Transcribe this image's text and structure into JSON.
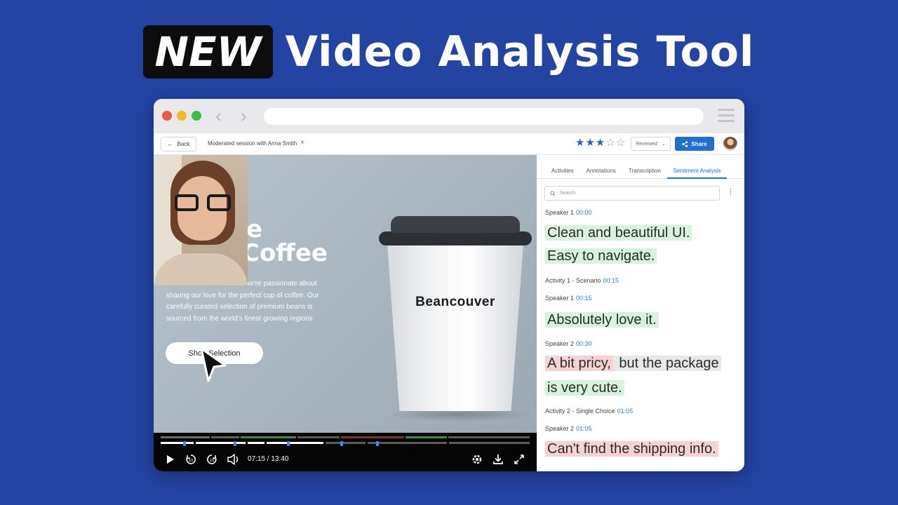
{
  "headline": {
    "badge": "NEW",
    "title": "Video Analysis Tool"
  },
  "app_bar": {
    "back_label": "Back",
    "session_title": "Moderated session with Anna Smith",
    "close_glyph": "×",
    "rating": {
      "value": 3,
      "max": 5
    },
    "status_value": "Reviewed",
    "share_label": "Share"
  },
  "video": {
    "hero_line1": "e",
    "hero_line2": "Coffee",
    "description": "At our coffee bean store, we're passionate about sharing our love for the perfect cup of coffee. Our carefully curated selection of premium beans is sourced from the world's finest growing regions",
    "shop_button": "Shop Selection",
    "cup_brand": "Beancouver"
  },
  "player": {
    "time_display": "07:15 / 13:40",
    "progress_fraction": 0.53,
    "icons": [
      "play-icon",
      "rewind-10-icon",
      "forward-10-icon",
      "volume-icon",
      "settings-icon",
      "download-icon",
      "fullscreen-icon"
    ]
  },
  "panel": {
    "tabs": [
      "Activities",
      "Annotations",
      "Transcription",
      "Sentiment Analysis"
    ],
    "active_tab": "Sentiment Analysis",
    "search_placeholder": "Search",
    "entries": [
      {
        "label": "Speaker 1",
        "time": "00:00"
      },
      {
        "label": "Activity 1 - Scenario",
        "time": "00:15"
      },
      {
        "label": "Speaker 1",
        "time": "00:15"
      },
      {
        "label": "Speaker 2",
        "time": "00:30"
      },
      {
        "label": "Activity 2 - Single Choice",
        "time": "01:05"
      },
      {
        "label": "Speaker 2",
        "time": "01:05"
      }
    ],
    "quotes": {
      "q1a": "Clean and beautiful UI.",
      "q1b": "Easy to navigate.",
      "q2": "Absolutely love it.",
      "q3a": "A bit pricy,",
      "q3b": " but the package",
      "q3c": "is very cute.",
      "q4": "Can't find the shipping info."
    }
  },
  "colors": {
    "background": "#2344a3",
    "accent": "#1f6fd1",
    "positive_highlight": "#d7f2dd",
    "negative_highlight": "#f6d2d4",
    "neutral_highlight": "#e8e8e8"
  }
}
